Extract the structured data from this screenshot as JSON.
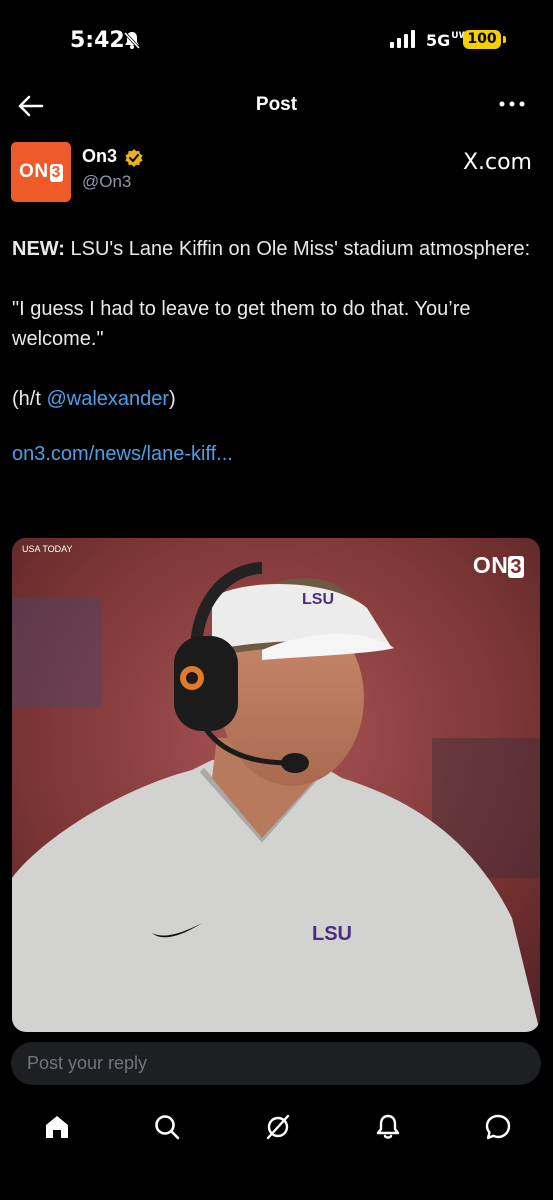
{
  "status_bar": {
    "time": "5:42",
    "network": "5G",
    "network_sup": "UW",
    "battery": "100"
  },
  "topbar": {
    "title": "Post"
  },
  "author": {
    "avatar_text": "ON",
    "avatar_digit": "3",
    "name": "On3",
    "handle": "@On3",
    "source": "X.com"
  },
  "tweet": {
    "lead": "NEW:",
    "line1": " LSU's Lane Kiffin on Ole Miss' stadium atmosphere:",
    "quote": "\"I guess I had to leave to get them to do that. You’re welcome.\"",
    "ht_prefix": "(h/t ",
    "ht_mention": "@walexander",
    "ht_suffix": ")",
    "link": "on3.com/news/lane-kiff..."
  },
  "media": {
    "credit": "USA TODAY",
    "watermark_text": "ON",
    "watermark_digit": "3",
    "visor_logo": "LSU",
    "shirt_logo": "LSU"
  },
  "reply": {
    "placeholder": "Post your reply"
  },
  "nav": {
    "items": [
      "home-icon",
      "search-icon",
      "grok-icon",
      "notifications-icon",
      "messages-icon"
    ]
  },
  "colors": {
    "accent_link": "#4d9fe8",
    "brand_orange": "#ef5a2b",
    "verified_gold": "#e8b123",
    "battery_yellow": "#f5d000"
  }
}
